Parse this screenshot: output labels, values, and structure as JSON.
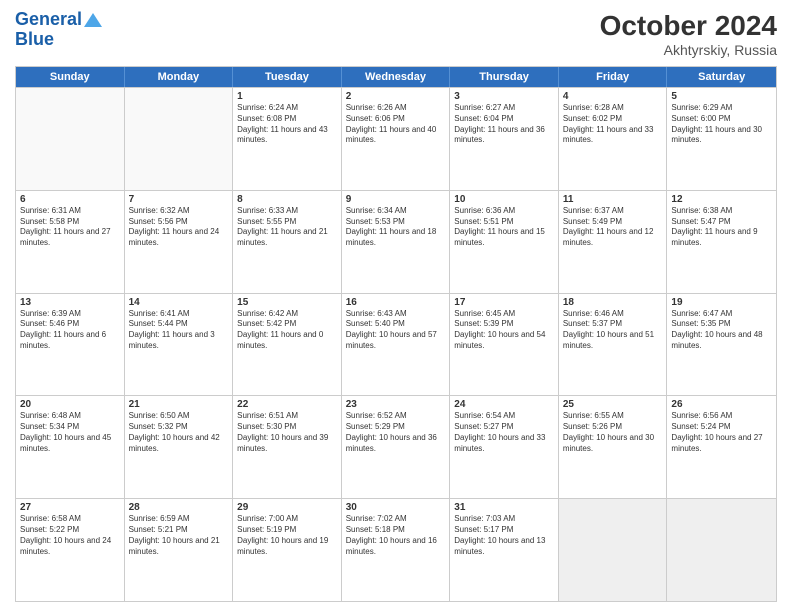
{
  "header": {
    "logo_line1": "General",
    "logo_line2": "Blue",
    "title": "October 2024",
    "location": "Akhtyrskiy, Russia"
  },
  "days_of_week": [
    "Sunday",
    "Monday",
    "Tuesday",
    "Wednesday",
    "Thursday",
    "Friday",
    "Saturday"
  ],
  "weeks": [
    [
      {
        "day": "",
        "info": ""
      },
      {
        "day": "",
        "info": ""
      },
      {
        "day": "1",
        "info": "Sunrise: 6:24 AM\nSunset: 6:08 PM\nDaylight: 11 hours and 43 minutes."
      },
      {
        "day": "2",
        "info": "Sunrise: 6:26 AM\nSunset: 6:06 PM\nDaylight: 11 hours and 40 minutes."
      },
      {
        "day": "3",
        "info": "Sunrise: 6:27 AM\nSunset: 6:04 PM\nDaylight: 11 hours and 36 minutes."
      },
      {
        "day": "4",
        "info": "Sunrise: 6:28 AM\nSunset: 6:02 PM\nDaylight: 11 hours and 33 minutes."
      },
      {
        "day": "5",
        "info": "Sunrise: 6:29 AM\nSunset: 6:00 PM\nDaylight: 11 hours and 30 minutes."
      }
    ],
    [
      {
        "day": "6",
        "info": "Sunrise: 6:31 AM\nSunset: 5:58 PM\nDaylight: 11 hours and 27 minutes."
      },
      {
        "day": "7",
        "info": "Sunrise: 6:32 AM\nSunset: 5:56 PM\nDaylight: 11 hours and 24 minutes."
      },
      {
        "day": "8",
        "info": "Sunrise: 6:33 AM\nSunset: 5:55 PM\nDaylight: 11 hours and 21 minutes."
      },
      {
        "day": "9",
        "info": "Sunrise: 6:34 AM\nSunset: 5:53 PM\nDaylight: 11 hours and 18 minutes."
      },
      {
        "day": "10",
        "info": "Sunrise: 6:36 AM\nSunset: 5:51 PM\nDaylight: 11 hours and 15 minutes."
      },
      {
        "day": "11",
        "info": "Sunrise: 6:37 AM\nSunset: 5:49 PM\nDaylight: 11 hours and 12 minutes."
      },
      {
        "day": "12",
        "info": "Sunrise: 6:38 AM\nSunset: 5:47 PM\nDaylight: 11 hours and 9 minutes."
      }
    ],
    [
      {
        "day": "13",
        "info": "Sunrise: 6:39 AM\nSunset: 5:46 PM\nDaylight: 11 hours and 6 minutes."
      },
      {
        "day": "14",
        "info": "Sunrise: 6:41 AM\nSunset: 5:44 PM\nDaylight: 11 hours and 3 minutes."
      },
      {
        "day": "15",
        "info": "Sunrise: 6:42 AM\nSunset: 5:42 PM\nDaylight: 11 hours and 0 minutes."
      },
      {
        "day": "16",
        "info": "Sunrise: 6:43 AM\nSunset: 5:40 PM\nDaylight: 10 hours and 57 minutes."
      },
      {
        "day": "17",
        "info": "Sunrise: 6:45 AM\nSunset: 5:39 PM\nDaylight: 10 hours and 54 minutes."
      },
      {
        "day": "18",
        "info": "Sunrise: 6:46 AM\nSunset: 5:37 PM\nDaylight: 10 hours and 51 minutes."
      },
      {
        "day": "19",
        "info": "Sunrise: 6:47 AM\nSunset: 5:35 PM\nDaylight: 10 hours and 48 minutes."
      }
    ],
    [
      {
        "day": "20",
        "info": "Sunrise: 6:48 AM\nSunset: 5:34 PM\nDaylight: 10 hours and 45 minutes."
      },
      {
        "day": "21",
        "info": "Sunrise: 6:50 AM\nSunset: 5:32 PM\nDaylight: 10 hours and 42 minutes."
      },
      {
        "day": "22",
        "info": "Sunrise: 6:51 AM\nSunset: 5:30 PM\nDaylight: 10 hours and 39 minutes."
      },
      {
        "day": "23",
        "info": "Sunrise: 6:52 AM\nSunset: 5:29 PM\nDaylight: 10 hours and 36 minutes."
      },
      {
        "day": "24",
        "info": "Sunrise: 6:54 AM\nSunset: 5:27 PM\nDaylight: 10 hours and 33 minutes."
      },
      {
        "day": "25",
        "info": "Sunrise: 6:55 AM\nSunset: 5:26 PM\nDaylight: 10 hours and 30 minutes."
      },
      {
        "day": "26",
        "info": "Sunrise: 6:56 AM\nSunset: 5:24 PM\nDaylight: 10 hours and 27 minutes."
      }
    ],
    [
      {
        "day": "27",
        "info": "Sunrise: 6:58 AM\nSunset: 5:22 PM\nDaylight: 10 hours and 24 minutes."
      },
      {
        "day": "28",
        "info": "Sunrise: 6:59 AM\nSunset: 5:21 PM\nDaylight: 10 hours and 21 minutes."
      },
      {
        "day": "29",
        "info": "Sunrise: 7:00 AM\nSunset: 5:19 PM\nDaylight: 10 hours and 19 minutes."
      },
      {
        "day": "30",
        "info": "Sunrise: 7:02 AM\nSunset: 5:18 PM\nDaylight: 10 hours and 16 minutes."
      },
      {
        "day": "31",
        "info": "Sunrise: 7:03 AM\nSunset: 5:17 PM\nDaylight: 10 hours and 13 minutes."
      },
      {
        "day": "",
        "info": ""
      },
      {
        "day": "",
        "info": ""
      }
    ]
  ]
}
